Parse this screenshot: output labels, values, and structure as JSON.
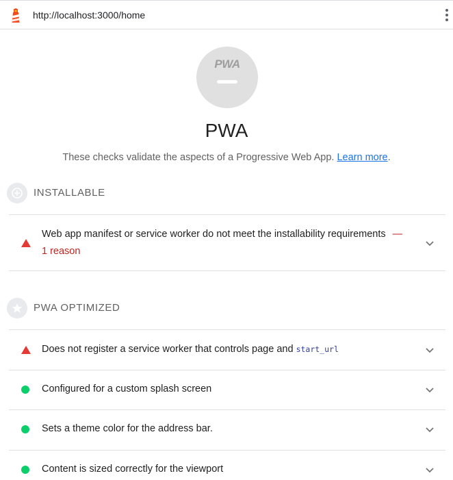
{
  "browser": {
    "url": "http://localhost:3000/home",
    "logo_icon": "lighthouse-icon",
    "menu_icon": "kebab-menu-icon"
  },
  "category": {
    "badge_text": "PWA",
    "title": "PWA",
    "description": "These checks validate the aspects of a Progressive Web App.",
    "learn_more": "Learn more",
    "period": "."
  },
  "groups": [
    {
      "title": "INSTALLABLE",
      "icon": "plus-circle-icon",
      "audits": [
        {
          "status": "fail",
          "text": "Web app manifest or service worker do not meet the installability requirements",
          "dash": "—",
          "detail": "1 reason"
        }
      ]
    },
    {
      "title": "PWA OPTIMIZED",
      "icon": "star-icon",
      "audits": [
        {
          "status": "fail",
          "text": "Does not register a service worker that controls page and",
          "code": "start_url"
        },
        {
          "status": "pass",
          "text": "Configured for a custom splash screen"
        },
        {
          "status": "pass",
          "text": "Sets a theme color for the address bar."
        },
        {
          "status": "pass",
          "text": "Content is sized correctly for the viewport"
        }
      ]
    }
  ],
  "colors": {
    "fail": "#e53935",
    "pass": "#0cce6b",
    "link": "#1a73e8",
    "fail_text": "#c5221f"
  }
}
